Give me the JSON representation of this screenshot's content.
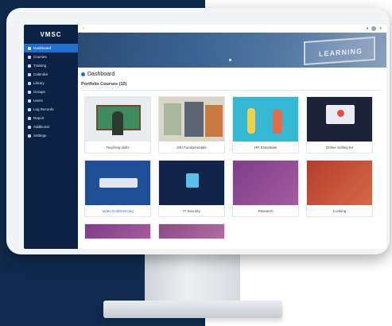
{
  "app": {
    "logo_text": "VMSC"
  },
  "sidebar": {
    "items": [
      {
        "label": "Dashboard",
        "active": true
      },
      {
        "label": "Courses"
      },
      {
        "label": "Training"
      },
      {
        "label": "Calendar"
      },
      {
        "label": "Library"
      },
      {
        "label": "Groups"
      },
      {
        "label": "Users"
      },
      {
        "label": "Log Records"
      },
      {
        "label": "Report"
      },
      {
        "label": "Additional"
      },
      {
        "label": "Settings"
      }
    ]
  },
  "banner": {
    "text": "LEARNING"
  },
  "page": {
    "title": "Dashboard",
    "section_title": "Portfolio Courses (10)"
  },
  "courses": [
    {
      "title": "Teaching skills"
    },
    {
      "title": "DEI Fundamentals"
    },
    {
      "title": "HR Essentials"
    },
    {
      "title": "Online Selling Kit"
    },
    {
      "title": "Video Conferencing"
    },
    {
      "title": "IT Security"
    },
    {
      "title": "Research"
    },
    {
      "title": "Cooking"
    },
    {
      "title": ""
    },
    {
      "title": ""
    }
  ],
  "colors": {
    "sidebar": "#0c2245",
    "accent": "#1e6fd0",
    "backdrop": "#0f2a4d"
  }
}
